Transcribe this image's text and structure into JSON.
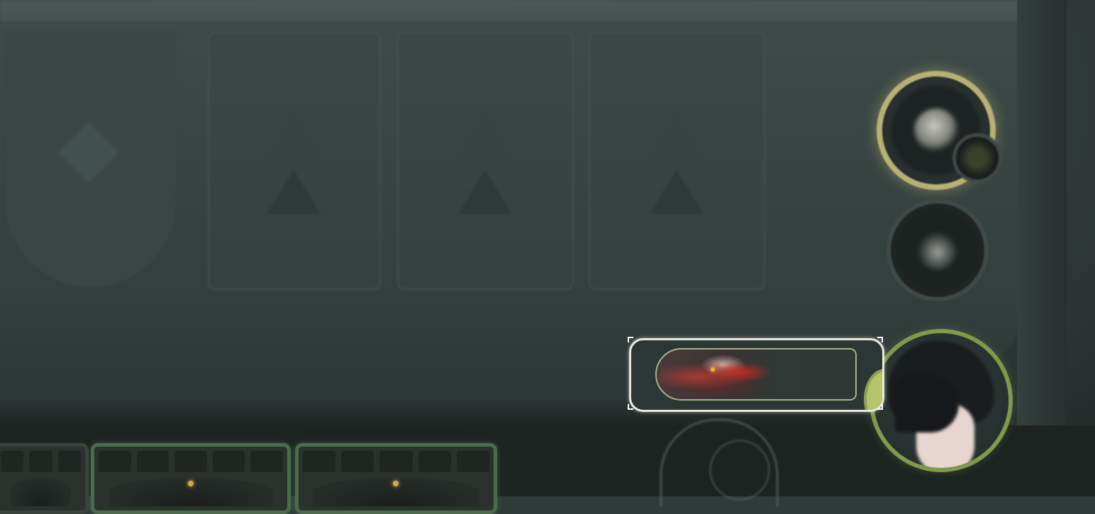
{
  "screen": {
    "name": "card-battle-board",
    "state": "blurred background with highlighted monster bar"
  },
  "equipment_slots": [
    {
      "id": "shield-slot",
      "icon": "shield-icon",
      "state": "empty"
    },
    {
      "id": "slot-2",
      "icon": "triangle-slot-icon",
      "state": "empty"
    },
    {
      "id": "slot-3",
      "icon": "triangle-slot-icon",
      "state": "empty"
    },
    {
      "id": "slot-4",
      "icon": "triangle-slot-icon",
      "state": "empty"
    }
  ],
  "right_controls": {
    "primary_button": {
      "icon": "skill-emblem-icon",
      "ring_color": "#b8b074"
    },
    "small_badge": {
      "icon": "badge-icon"
    },
    "secondary_button": {
      "icon": "emote-icon"
    },
    "player_portrait": {
      "ring_color": "#7e9a4a"
    }
  },
  "monster_bar": {
    "highlighted": true,
    "frame_color": "#e8e8dc",
    "inner_border_color": "#a9b08a",
    "creature_colors": [
      "#a43a36",
      "#c92a22",
      "#d5b4a8"
    ]
  },
  "hand_cards": [
    {
      "id": "hand-card-1",
      "highlighted": false
    },
    {
      "id": "hand-card-2",
      "highlighted": true
    },
    {
      "id": "hand-card-3",
      "highlighted": true
    }
  ],
  "colors": {
    "board": "#3b4746",
    "highlight_green": "#4b6b4a",
    "gold_ring": "#b8b074"
  }
}
